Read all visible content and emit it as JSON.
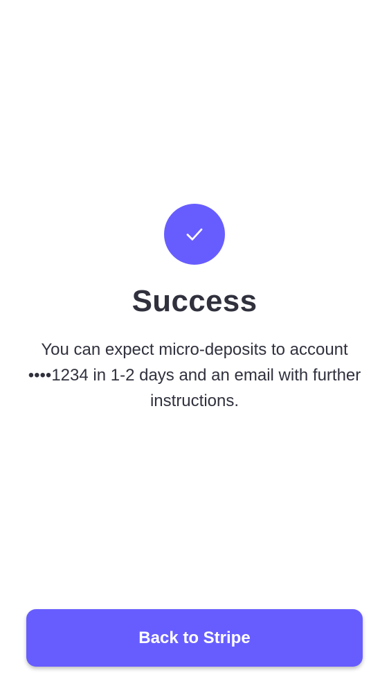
{
  "success": {
    "icon": "checkmark-icon",
    "title": "Success",
    "message": "You can expect micro-deposits to account ••••1234 in 1-2 days and an email with further instructions."
  },
  "footer": {
    "button_label": "Back to Stripe"
  },
  "colors": {
    "accent": "#675dff",
    "text": "#30313d",
    "background": "#ffffff"
  }
}
